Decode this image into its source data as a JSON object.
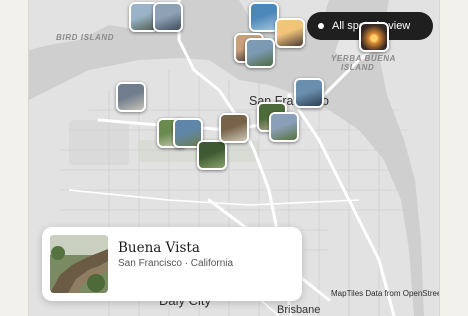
{
  "map": {
    "places": {
      "bird_island": "BIRD ISLAND",
      "yerba_buena_line1": "YERBA BUENA",
      "yerba_buena_line2": "ISLAND"
    },
    "cities": {
      "san_francisco": "San Francisco",
      "daly_city": "Daly City",
      "brisbane": "Brisbane"
    },
    "photo_pins": [
      {
        "name": "photo-pin-coast-rock",
        "palette": [
          "#6f7d8c",
          "#c8c3b8"
        ]
      },
      {
        "name": "photo-pin-bay-view",
        "palette": [
          "#9ab3c8",
          "#4c5d4e"
        ]
      },
      {
        "name": "photo-pin-bridge-north",
        "palette": [
          "#8fa2b5",
          "#3e4c5a"
        ]
      },
      {
        "name": "photo-pin-blue-water",
        "palette": [
          "#4b87b8",
          "#a7c6dd"
        ]
      },
      {
        "name": "photo-pin-sunset-pier",
        "palette": [
          "#f2c47a",
          "#4a3a34"
        ]
      },
      {
        "name": "photo-pin-dusk-skyline",
        "palette": [
          "#c9a07a",
          "#2c2a30"
        ]
      },
      {
        "name": "photo-pin-lands-end",
        "palette": [
          "#7c9bb2",
          "#506a45"
        ]
      },
      {
        "name": "photo-pin-downtown",
        "palette": [
          "#6a8fae",
          "#2e3f52"
        ]
      },
      {
        "name": "photo-pin-park-trail",
        "palette": [
          "#6b8a4e",
          "#c7cfb9"
        ]
      },
      {
        "name": "photo-pin-lake",
        "palette": [
          "#5f86a8",
          "#6d8050"
        ]
      },
      {
        "name": "photo-pin-hill-trees",
        "palette": [
          "#3f5a33",
          "#8aa36c"
        ]
      },
      {
        "name": "photo-pin-buena-vista",
        "palette": [
          "#776349",
          "#cfc9b8"
        ]
      },
      {
        "name": "photo-pin-cypress",
        "palette": [
          "#4d6a3a",
          "#b9b39a"
        ]
      },
      {
        "name": "photo-pin-twin-peaks",
        "palette": [
          "#8aa0b8",
          "#57733d"
        ]
      }
    ]
  },
  "spots_button": {
    "label": "All spots in view"
  },
  "selected_spot": {
    "title": "Buena Vista",
    "subtitle": "San Francisco · California"
  },
  "attribution": {
    "text": "MapTiles Data from OpenStreetM",
    "info_icon": "info-icon"
  },
  "colors": {
    "land": "#dedede",
    "water": "#cfcfcf",
    "road": "#ffffff",
    "pill": "#1f1f1f"
  }
}
